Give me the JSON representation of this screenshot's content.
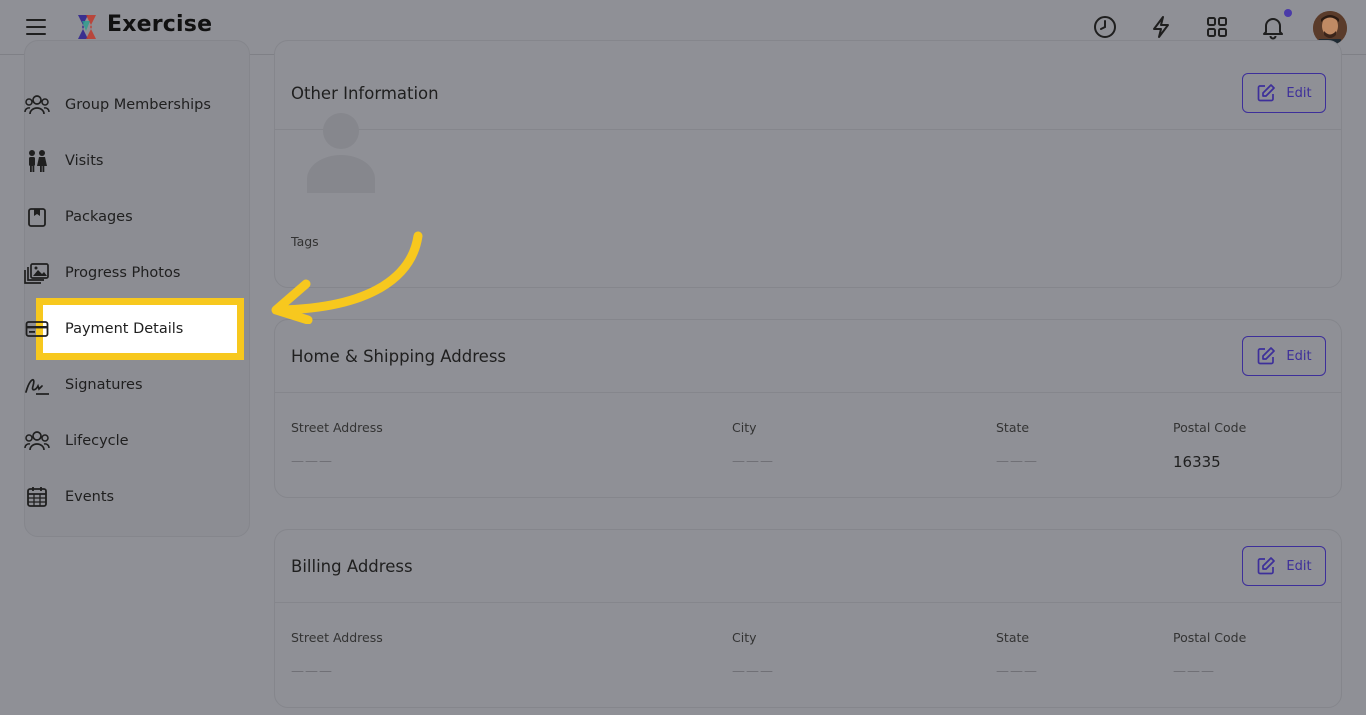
{
  "header": {
    "brand": "Exercise",
    "accent": "#3d2f9a"
  },
  "sidebar": {
    "items": [
      {
        "label": "Group Memberships",
        "icon": "group-icon"
      },
      {
        "label": "Visits",
        "icon": "visits-icon"
      },
      {
        "label": "Packages",
        "icon": "package-icon"
      },
      {
        "label": "Progress Photos",
        "icon": "photos-icon"
      },
      {
        "label": "Payment Details",
        "icon": "credit-card-icon"
      },
      {
        "label": "Signatures",
        "icon": "signature-icon"
      },
      {
        "label": "Lifecycle",
        "icon": "lifecycle-icon"
      },
      {
        "label": "Events",
        "icon": "calendar-icon"
      }
    ],
    "highlight_color": "#f7c81e"
  },
  "other_info": {
    "title": "Other Information",
    "edit_label": "Edit",
    "tags_label": "Tags"
  },
  "home_address": {
    "title": "Home & Shipping Address",
    "edit_label": "Edit",
    "street_label": "Street Address",
    "street_value": "———",
    "city_label": "City",
    "city_value": "———",
    "state_label": "State",
    "state_value": "———",
    "postal_label": "Postal Code",
    "postal_value": "16335"
  },
  "billing_address": {
    "title": "Billing Address",
    "edit_label": "Edit",
    "street_label": "Street Address",
    "street_value": "———",
    "city_label": "City",
    "city_value": "———",
    "state_label": "State",
    "state_value": "———",
    "postal_label": "Postal Code",
    "postal_value": "———"
  }
}
